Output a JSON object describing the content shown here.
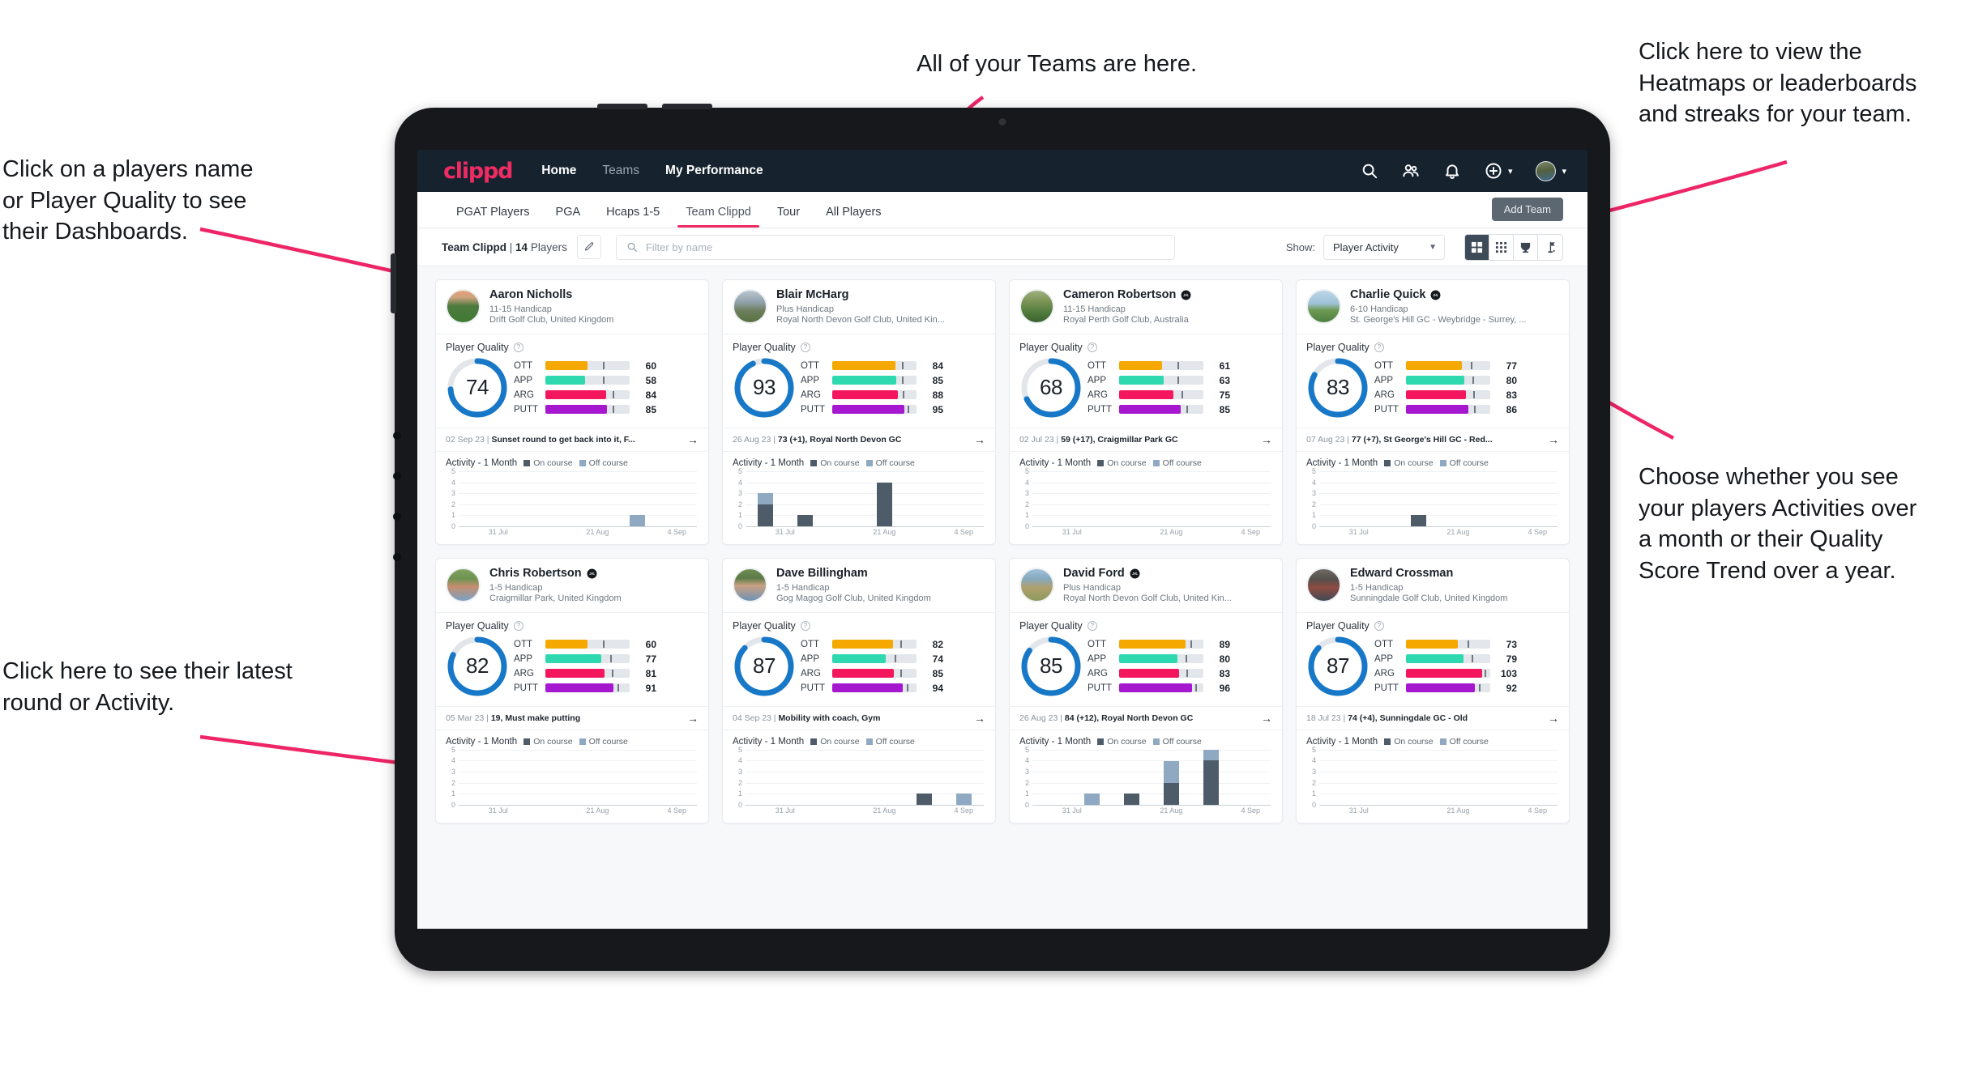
{
  "annotations": [
    {
      "id": "teams",
      "text": "All of your Teams are here."
    },
    {
      "id": "heatmaps",
      "text": "Click here to view the\nHeatmaps or leaderboards\nand streaks for your team."
    },
    {
      "id": "playername",
      "text": "Click on a players name\nor Player Quality to see\ntheir Dashboards."
    },
    {
      "id": "activity-toggle",
      "text": "Choose whether you see\nyour players Activities over\na month or their Quality\nScore Trend over a year."
    },
    {
      "id": "latest-round",
      "text": "Click here to see their latest\nround or Activity."
    }
  ],
  "navbar": {
    "brand": "clippd",
    "links": [
      {
        "label": "Home",
        "active": true
      },
      {
        "label": "Teams",
        "active": false
      },
      {
        "label": "My Performance",
        "active": true
      }
    ],
    "icons": [
      "search-icon",
      "people-icon",
      "bell-icon",
      "plus-circle-icon",
      "avatar"
    ]
  },
  "tabs": [
    {
      "label": "PGAT Players",
      "active": false
    },
    {
      "label": "PGA",
      "active": false
    },
    {
      "label": "Hcaps 1-5",
      "active": false
    },
    {
      "label": "Team Clippd",
      "active": true
    },
    {
      "label": "Tour",
      "active": false
    },
    {
      "label": "All Players",
      "active": false
    }
  ],
  "add_team_label": "Add Team",
  "toolbar": {
    "team_name": "Team Clippd",
    "separator": " | ",
    "player_count": "14",
    "players_word": " Players",
    "edit_icon": "pencil-icon",
    "search_placeholder": "Filter by name",
    "search_value": "",
    "show_label": "Show:",
    "show_value": "Player Activity",
    "show_options": [
      "Player Activity",
      "Quality Score Trend"
    ],
    "views": [
      {
        "name": "grid-view",
        "active": true
      },
      {
        "name": "dots-grid-view",
        "active": false
      },
      {
        "name": "trophy-view",
        "active": false
      },
      {
        "name": "flag-view",
        "active": false
      }
    ]
  },
  "card_labels": {
    "player_quality": "Player Quality",
    "activity_title": "Activity - 1 Month",
    "legend_on": "On course",
    "legend_off": "Off course",
    "metric_names": [
      "OTT",
      "APP",
      "ARG",
      "PUTT"
    ],
    "y_ticks": [
      "5",
      "4",
      "3",
      "2",
      "1",
      "0"
    ],
    "x_ticks": [
      "31 Jul",
      "21 Aug",
      "4 Sep"
    ]
  },
  "colors": {
    "brand_pink": "#ef2b63",
    "navbar_bg": "#16232f",
    "ott": "#f5a800",
    "app": "#2ed9b0",
    "arg": "#f4175e",
    "putt": "#a617d0",
    "ring": "#1878c8",
    "on_course": "#4e5c69",
    "off_course": "#8ea9c1",
    "annotation_arrow": "#ee2566"
  },
  "players": [
    {
      "name": "Aaron Nicholls",
      "verified": false,
      "handicap": "11-15 Handicap",
      "club": "Drift Golf Club, United Kingdom",
      "quality": 74,
      "avatar_css": "linear-gradient(180deg,#e9a07a 0%,#caa27e 22%,#4e7b3f 48%,#3f7a34 100%)",
      "metrics": [
        {
          "key": "OTT",
          "value": 60,
          "fill": 50,
          "tick": 68
        },
        {
          "key": "APP",
          "value": 58,
          "fill": 47,
          "tick": 68
        },
        {
          "key": "ARG",
          "value": 84,
          "fill": 72,
          "tick": 80
        },
        {
          "key": "PUTT",
          "value": 85,
          "fill": 73,
          "tick": 80
        }
      ],
      "round_date": "02 Sep 23",
      "round_text": "Sunset round to get back into it, F...",
      "activity": [
        {
          "on": 0,
          "off": 0
        },
        {
          "on": 0,
          "off": 0
        },
        {
          "on": 0,
          "off": 0
        },
        {
          "on": 0,
          "off": 0
        },
        {
          "on": 0,
          "off": 1
        },
        {
          "on": 0,
          "off": 0
        }
      ]
    },
    {
      "name": "Blair McHarg",
      "verified": false,
      "handicap": "Plus Handicap",
      "club": "Royal North Devon Golf Club, United Kin...",
      "quality": 93,
      "avatar_css": "linear-gradient(180deg,#b9c6cf 0%,#8f9fa9 38%,#6f8060 62%,#56703f 100%)",
      "metrics": [
        {
          "key": "OTT",
          "value": 84,
          "fill": 75,
          "tick": 83
        },
        {
          "key": "APP",
          "value": 85,
          "fill": 76,
          "tick": 83
        },
        {
          "key": "ARG",
          "value": 88,
          "fill": 78,
          "tick": 84
        },
        {
          "key": "PUTT",
          "value": 95,
          "fill": 86,
          "tick": 89
        }
      ],
      "round_date": "26 Aug 23",
      "round_text": "73 (+1), Royal North Devon GC",
      "activity": [
        {
          "on": 2,
          "off": 1
        },
        {
          "on": 1,
          "off": 0
        },
        {
          "on": 0,
          "off": 0
        },
        {
          "on": 4,
          "off": 0
        },
        {
          "on": 0,
          "off": 0
        },
        {
          "on": 0,
          "off": 0
        }
      ]
    },
    {
      "name": "Cameron Robertson",
      "verified": true,
      "handicap": "11-15 Handicap",
      "club": "Royal Perth Golf Club, Australia",
      "quality": 68,
      "avatar_css": "linear-gradient(180deg,#9fb07f 0%,#7b9455 35%,#4f7a3b 70%,#3a6330 100%)",
      "metrics": [
        {
          "key": "OTT",
          "value": 61,
          "fill": 51,
          "tick": 69
        },
        {
          "key": "APP",
          "value": 63,
          "fill": 53,
          "tick": 69
        },
        {
          "key": "ARG",
          "value": 75,
          "fill": 64,
          "tick": 74
        },
        {
          "key": "PUTT",
          "value": 85,
          "fill": 73,
          "tick": 80
        }
      ],
      "round_date": "02 Jul 23",
      "round_text": "59 (+17), Craigmillar Park GC",
      "activity": [
        {
          "on": 0,
          "off": 0
        },
        {
          "on": 0,
          "off": 0
        },
        {
          "on": 0,
          "off": 0
        },
        {
          "on": 0,
          "off": 0
        },
        {
          "on": 0,
          "off": 0
        },
        {
          "on": 0,
          "off": 0
        }
      ]
    },
    {
      "name": "Charlie Quick",
      "verified": true,
      "handicap": "6-10 Handicap",
      "club": "St. George's Hill GC - Weybridge - Surrey, ...",
      "quality": 83,
      "avatar_css": "linear-gradient(180deg,#bcd7e8 0%,#9fc2d8 40%,#6d9a53 62%,#4f8040 100%)",
      "metrics": [
        {
          "key": "OTT",
          "value": 77,
          "fill": 66,
          "tick": 77
        },
        {
          "key": "APP",
          "value": 80,
          "fill": 69,
          "tick": 79
        },
        {
          "key": "ARG",
          "value": 83,
          "fill": 71,
          "tick": 80
        },
        {
          "key": "PUTT",
          "value": 86,
          "fill": 74,
          "tick": 81
        }
      ],
      "round_date": "07 Aug 23",
      "round_text": "77 (+7), St George's Hill GC - Red...",
      "activity": [
        {
          "on": 0,
          "off": 0
        },
        {
          "on": 0,
          "off": 0
        },
        {
          "on": 1,
          "off": 0
        },
        {
          "on": 0,
          "off": 0
        },
        {
          "on": 0,
          "off": 0
        },
        {
          "on": 0,
          "off": 0
        }
      ]
    },
    {
      "name": "Chris Robertson",
      "verified": true,
      "handicap": "1-5 Handicap",
      "club": "Craigmillar Park, United Kingdom",
      "quality": 82,
      "avatar_css": "linear-gradient(180deg,#7fa35e 0%,#6e9352 30%,#c58e6e 55%,#7aa2c6 100%)",
      "metrics": [
        {
          "key": "OTT",
          "value": 60,
          "fill": 50,
          "tick": 68
        },
        {
          "key": "APP",
          "value": 77,
          "fill": 66,
          "tick": 77
        },
        {
          "key": "ARG",
          "value": 81,
          "fill": 70,
          "tick": 79
        },
        {
          "key": "PUTT",
          "value": 91,
          "fill": 81,
          "tick": 86
        }
      ],
      "round_date": "05 Mar 23",
      "round_text": "19, Must make putting",
      "activity": [
        {
          "on": 0,
          "off": 0
        },
        {
          "on": 0,
          "off": 0
        },
        {
          "on": 0,
          "off": 0
        },
        {
          "on": 0,
          "off": 0
        },
        {
          "on": 0,
          "off": 0
        },
        {
          "on": 0,
          "off": 0
        }
      ]
    },
    {
      "name": "Dave Billingham",
      "verified": false,
      "handicap": "1-5 Handicap",
      "club": "Gog Magog Golf Club, United Kingdom",
      "quality": 87,
      "avatar_css": "linear-gradient(180deg,#6f8f55 0%,#5b7a46 28%,#caa183 52%,#6d93b5 100%)",
      "metrics": [
        {
          "key": "OTT",
          "value": 82,
          "fill": 72,
          "tick": 81
        },
        {
          "key": "APP",
          "value": 74,
          "fill": 63,
          "tick": 74
        },
        {
          "key": "ARG",
          "value": 85,
          "fill": 73,
          "tick": 81
        },
        {
          "key": "PUTT",
          "value": 94,
          "fill": 84,
          "tick": 88
        }
      ],
      "round_date": "04 Sep 23",
      "round_text": "Mobility with coach, Gym",
      "activity": [
        {
          "on": 0,
          "off": 0
        },
        {
          "on": 0,
          "off": 0
        },
        {
          "on": 0,
          "off": 0
        },
        {
          "on": 0,
          "off": 0
        },
        {
          "on": 1,
          "off": 0
        },
        {
          "on": 0,
          "off": 1
        }
      ]
    },
    {
      "name": "David Ford",
      "verified": true,
      "handicap": "Plus Handicap",
      "club": "Royal North Devon Golf Club, United Kin...",
      "quality": 85,
      "avatar_css": "linear-gradient(180deg,#9fc0d6 0%,#86a9c0 30%,#b0a06e 58%,#8c9a5e 100%)",
      "metrics": [
        {
          "key": "OTT",
          "value": 89,
          "fill": 79,
          "tick": 85
        },
        {
          "key": "APP",
          "value": 80,
          "fill": 69,
          "tick": 79
        },
        {
          "key": "ARG",
          "value": 83,
          "fill": 71,
          "tick": 80
        },
        {
          "key": "PUTT",
          "value": 96,
          "fill": 87,
          "tick": 90
        }
      ],
      "round_date": "26 Aug 23",
      "round_text": "84 (+12), Royal North Devon GC",
      "activity": [
        {
          "on": 0,
          "off": 0
        },
        {
          "on": 0,
          "off": 1
        },
        {
          "on": 1,
          "off": 0
        },
        {
          "on": 2,
          "off": 2
        },
        {
          "on": 4,
          "off": 1
        },
        {
          "on": 0,
          "off": 0
        }
      ]
    },
    {
      "name": "Edward Crossman",
      "verified": false,
      "handicap": "1-5 Handicap",
      "club": "Sunningdale Golf Club, United Kingdom",
      "quality": 87,
      "avatar_css": "linear-gradient(180deg,#6e6a63 0%,#54514c 32%,#8e4b42 58%,#3f4a55 100%)",
      "metrics": [
        {
          "key": "OTT",
          "value": 73,
          "fill": 62,
          "tick": 73
        },
        {
          "key": "APP",
          "value": 79,
          "fill": 68,
          "tick": 78
        },
        {
          "key": "ARG",
          "value": 103,
          "fill": 90,
          "tick": 93
        },
        {
          "key": "PUTT",
          "value": 92,
          "fill": 82,
          "tick": 87
        }
      ],
      "round_date": "18 Jul 23",
      "round_text": "74 (+4), Sunningdale GC - Old",
      "activity": [
        {
          "on": 0,
          "off": 0
        },
        {
          "on": 0,
          "off": 0
        },
        {
          "on": 0,
          "off": 0
        },
        {
          "on": 0,
          "off": 0
        },
        {
          "on": 0,
          "off": 0
        },
        {
          "on": 0,
          "off": 0
        }
      ]
    }
  ]
}
